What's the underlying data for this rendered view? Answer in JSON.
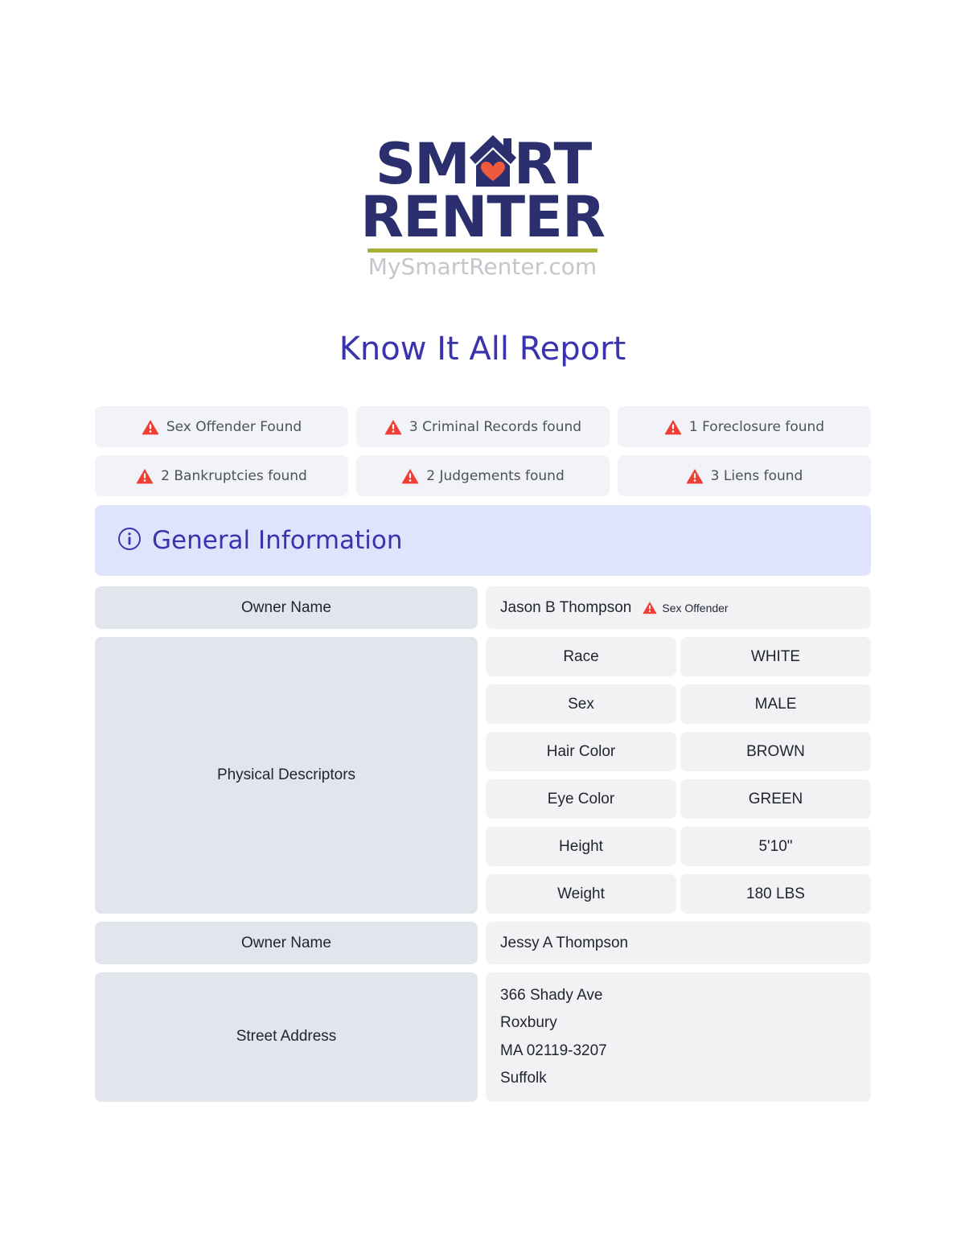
{
  "logo": {
    "line1_part1": "SM",
    "line1_house_icon": "house-heart-icon",
    "line1_part2": "RT",
    "line2": "RENTER",
    "domain": "MySmartRenter.com"
  },
  "report": {
    "title": "Know It All Report"
  },
  "alerts": [
    {
      "icon": "warning-triangle-icon",
      "label": "Sex Offender Found"
    },
    {
      "icon": "warning-triangle-icon",
      "label": "3 Criminal Records found"
    },
    {
      "icon": "warning-triangle-icon",
      "label": "1 Foreclosure found"
    },
    {
      "icon": "warning-triangle-icon",
      "label": "2 Bankruptcies found"
    },
    {
      "icon": "warning-triangle-icon",
      "label": "2 Judgements found"
    },
    {
      "icon": "warning-triangle-icon",
      "label": "3 Liens found"
    }
  ],
  "section": {
    "icon": "info-circle-icon",
    "title": "General Information"
  },
  "general_information": {
    "owner_name_1": {
      "label": "Owner Name",
      "value": "Jason B Thompson",
      "flag_icon": "warning-triangle-icon",
      "flag_label": "Sex Offender"
    },
    "physical_descriptors": {
      "label": "Physical Descriptors",
      "rows": [
        {
          "key": "Race",
          "value": "WHITE"
        },
        {
          "key": "Sex",
          "value": "MALE"
        },
        {
          "key": "Hair Color",
          "value": "BROWN"
        },
        {
          "key": "Eye Color",
          "value": "GREEN"
        },
        {
          "key": "Height",
          "value": "5'10\""
        },
        {
          "key": "Weight",
          "value": "180 LBS"
        }
      ]
    },
    "owner_name_2": {
      "label": "Owner Name",
      "value": "Jessy A Thompson"
    },
    "street_address": {
      "label": "Street Address",
      "lines": [
        "366 Shady Ave",
        "Roxbury",
        "MA 02119-3207",
        "Suffolk"
      ]
    }
  },
  "colors": {
    "brand_navy": "#2b2f6e",
    "brand_olive": "#a9ae35",
    "title_indigo": "#3b32ae",
    "alert_red": "#ef3e33",
    "badge_bg": "#f1f3f8",
    "section_bg": "#dfe3fb",
    "label_bg": "#e2e5eb",
    "value_bg": "#f2f2f4"
  }
}
